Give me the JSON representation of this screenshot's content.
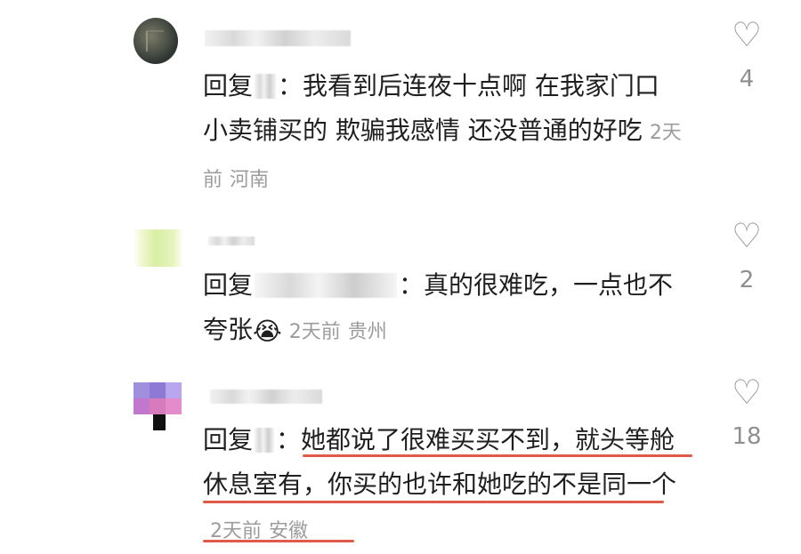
{
  "comments": [
    {
      "reply_prefix": "回复",
      "text": "：我看到后连夜十点啊 在我家门口小卖铺买的 欺骗我感情 还没普通的好吃",
      "time": "2天前",
      "location": "河南",
      "like_count": "4"
    },
    {
      "reply_prefix": "回复",
      "text": "：真的很难吃，一点也不夸张",
      "emoji": "😭",
      "time": "2天前",
      "location": "贵州",
      "like_count": "2"
    },
    {
      "reply_prefix": "回复",
      "text": "：她都说了很难买买不到，就头等舱休息室有，你买的也许和她吃的不是同一个",
      "time": "2天前",
      "location": "安徽",
      "like_count": "18",
      "underline_color": "#e05a4a"
    }
  ],
  "icons": {
    "like": "heart-outline-icon"
  }
}
